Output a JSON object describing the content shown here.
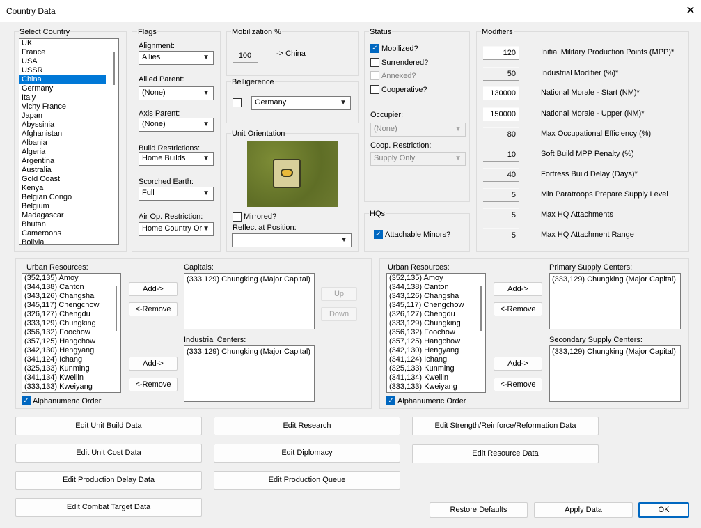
{
  "window": {
    "title": "Country Data",
    "close_icon": "close-icon"
  },
  "select_country": {
    "label": "Select Country",
    "items": [
      "UK",
      "France",
      "USA",
      "USSR",
      "China",
      "Germany",
      "Italy",
      "Vichy France",
      "Japan",
      "Abyssinia",
      "Afghanistan",
      "Albania",
      "Algeria",
      "Argentina",
      "Australia",
      "Gold Coast",
      "Kenya",
      "Belgian Congo",
      "Belgium",
      "Madagascar",
      "Bhutan",
      "Cameroons",
      "Bolivia"
    ],
    "selected": "China"
  },
  "flags": {
    "label": "Flags",
    "alignment": {
      "label": "Alignment:",
      "value": "Allies"
    },
    "allied_parent": {
      "label": "Allied Parent:",
      "value": "(None)"
    },
    "axis_parent": {
      "label": "Axis Parent:",
      "value": "(None)"
    },
    "build_restrictions": {
      "label": "Build Restrictions:",
      "value": "Home Builds"
    },
    "scorched_earth": {
      "label": "Scorched Earth:",
      "value": "Full"
    },
    "air_op_restriction": {
      "label": "Air Op. Restriction:",
      "value": "Home Country Or"
    }
  },
  "mobilization": {
    "label": "Mobilization %",
    "value": "100",
    "target": "-> China"
  },
  "belligerence": {
    "label": "Belligerence",
    "checked": false,
    "value": "Germany"
  },
  "unit_orientation": {
    "label": "Unit Orientation",
    "mirrored_label": "Mirrored?",
    "mirrored": false,
    "reflect_label": "Reflect at Position:",
    "reflect_value": ""
  },
  "status": {
    "label": "Status",
    "mobilized": {
      "label": "Mobilized?",
      "checked": true
    },
    "surrendered": {
      "label": "Surrendered?",
      "checked": false
    },
    "annexed": {
      "label": "Annexed?",
      "checked": false
    },
    "cooperative": {
      "label": "Cooperative?",
      "checked": false
    },
    "occupier": {
      "label": "Occupier:",
      "value": "(None)"
    },
    "coop_restriction": {
      "label": "Coop. Restriction:",
      "value": "Supply Only"
    }
  },
  "hqs": {
    "label": "HQs",
    "attachable_minors": {
      "label": "Attachable Minors?",
      "checked": true
    }
  },
  "modifiers": {
    "label": "Modifiers",
    "rows": [
      {
        "value": "120",
        "label": "Initial Military Production Points (MPP)*",
        "editable": true
      },
      {
        "value": "50",
        "label": "Industrial Modifier (%)*",
        "editable": false
      },
      {
        "value": "130000",
        "label": "National Morale - Start (NM)*",
        "editable": true
      },
      {
        "value": "150000",
        "label": "National Morale - Upper (NM)*",
        "editable": true
      },
      {
        "value": "80",
        "label": "Max Occupational Efficiency (%)",
        "editable": false
      },
      {
        "value": "10",
        "label": "Soft Build MPP Penalty (%)",
        "editable": false
      },
      {
        "value": "40",
        "label": "Fortress Build Delay (Days)*",
        "editable": false
      },
      {
        "value": "5",
        "label": "Min Paratroops Prepare Supply Level",
        "editable": false
      },
      {
        "value": "5",
        "label": "Max HQ Attachments",
        "editable": false
      },
      {
        "value": "5",
        "label": "Max HQ Attachment Range",
        "editable": false
      }
    ]
  },
  "urban_resources": [
    "(352,135) Amoy",
    "(344,138) Canton",
    "(343,126) Changsha",
    "(345,117) Chengchow",
    "(326,127) Chengdu",
    "(333,129) Chungking",
    "(356,132) Foochow",
    "(357,125) Hangchow",
    "(342,130) Hengyang",
    "(341,124) Ichang",
    "(325,133) Kunming",
    "(341,134) Kweilin",
    "(333,133) Kweiyang"
  ],
  "left_panel": {
    "urban_label": "Urban Resources:",
    "add_label": "Add->",
    "remove_label": "<-Remove",
    "capitals_label": "Capitals:",
    "capitals": [
      "(333,129) Chungking (Major Capital)"
    ],
    "industrial_label": "Industrial Centers:",
    "industrial": [
      "(333,129) Chungking (Major Capital)"
    ],
    "up_label": "Up",
    "down_label": "Down",
    "alpha_label": "Alphanumeric Order",
    "alpha_checked": true
  },
  "right_panel": {
    "urban_label": "Urban Resources:",
    "add_label": "Add->",
    "remove_label": "<-Remove",
    "primary_label": "Primary Supply Centers:",
    "primary": [
      "(333,129) Chungking (Major Capital)"
    ],
    "secondary_label": "Secondary Supply Centers:",
    "secondary": [
      "(333,129) Chungking (Major Capital)"
    ],
    "alpha_label": "Alphanumeric Order",
    "alpha_checked": true
  },
  "buttons": {
    "unit_build": "Edit Unit Build Data",
    "research": "Edit Research",
    "strength": "Edit Strength/Reinforce/Reformation Data",
    "unit_cost": "Edit Unit Cost Data",
    "diplomacy": "Edit Diplomacy",
    "resource": "Edit Resource Data",
    "production_delay": "Edit Production Delay Data",
    "production_queue": "Edit Production Queue",
    "combat_target": "Edit Combat Target Data",
    "restore": "Restore Defaults",
    "apply": "Apply Data",
    "ok": "OK"
  },
  "colors": {
    "accent": "#0067c0",
    "selection": "#0078d7",
    "map_green": "#6b7a2c"
  }
}
